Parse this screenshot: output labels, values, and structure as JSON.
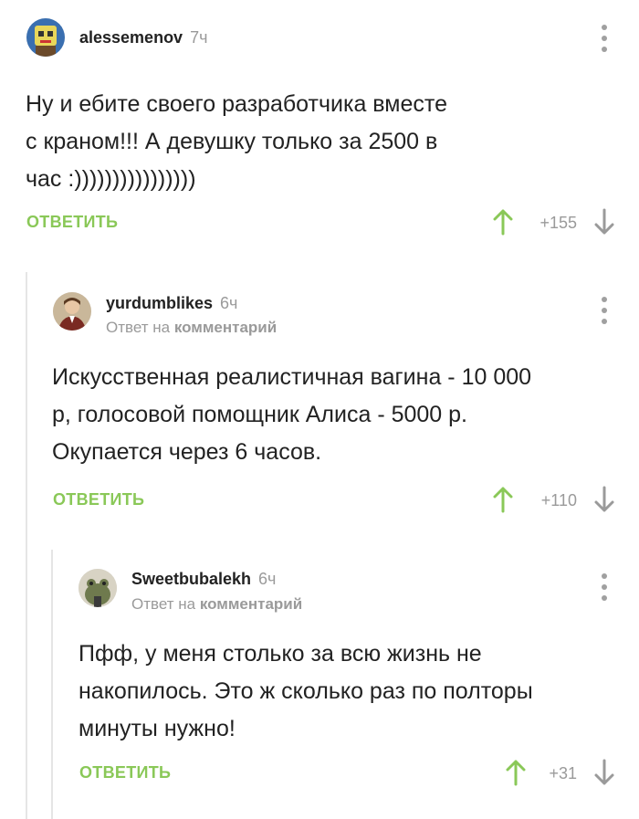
{
  "colors": {
    "accent": "#8ac858",
    "muted": "#9a9a9a",
    "text": "#222222",
    "thread_line": "#e5e5e5"
  },
  "comments": [
    {
      "username": "alessemenov",
      "time": "7ч",
      "text": "Ну и ебите своего разработчика вместе\nс краном!!! А девушку только за 2500 в\nчас :))))))))))))))))",
      "reply_label": "ОТВЕТИТЬ",
      "rating": "+155",
      "avatar_icon": "avatar-icon"
    },
    {
      "username": "yurdumblikes",
      "time": "6ч",
      "reply_to_prefix": "Ответ на",
      "reply_to_target": "комментарий",
      "text": "Искусственная реалистичная вагина - 10 000\nр, голосовой помощник Алиса - 5000 р.\nОкупается через 6 часов.",
      "reply_label": "ОТВЕТИТЬ",
      "rating": "+110",
      "avatar_icon": "avatar-icon"
    },
    {
      "username": "Sweetbubalekh",
      "time": "6ч",
      "reply_to_prefix": "Ответ на",
      "reply_to_target": "комментарий",
      "text": "Пфф, у меня столько за всю жизнь не\nнакопилось. Это ж сколько раз по полторы\nминуты нужно!",
      "reply_label": "ОТВЕТИТЬ",
      "rating": "+31",
      "avatar_icon": "avatar-icon"
    }
  ]
}
